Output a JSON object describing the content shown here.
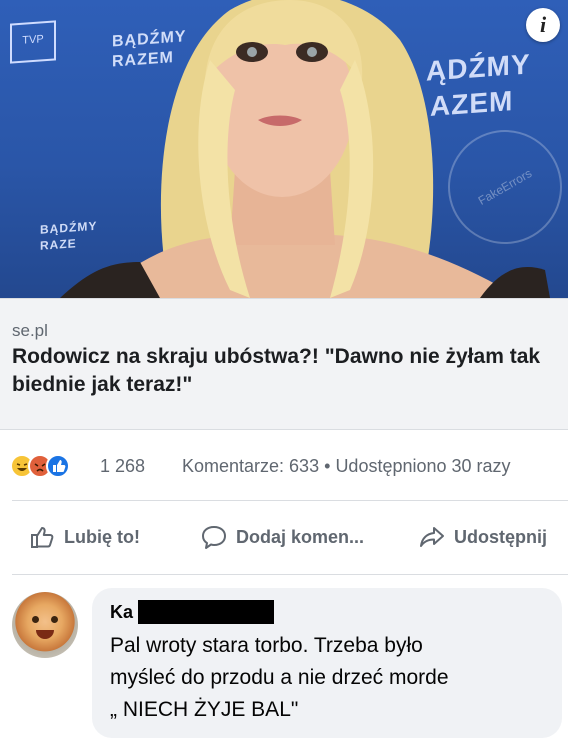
{
  "post_image": {
    "tv_logo": "TVP",
    "backdrop_text_left": "BĄDŹMY RAZEM",
    "backdrop_text_right_1": "ĄDŹMY",
    "backdrop_text_right_2": "AZEM",
    "backdrop_text_low": "BĄDŹMY RAZE",
    "watermark": "FakeErrors",
    "info_icon": "info-icon"
  },
  "link_preview": {
    "domain": "se.pl",
    "title": "Rodowicz na skraju ubóstwa?! \"Dawno nie żyłam tak biednie jak teraz!\""
  },
  "stats": {
    "reaction_icons": [
      "haha-icon",
      "angry-icon",
      "like-icon"
    ],
    "reaction_count": "1 268",
    "comments": "Komentarze: 633",
    "separator": "•",
    "shares": "Udostępniono 30 razy"
  },
  "actions": {
    "like_label": "Lubię to!",
    "comment_label": "Dodaj komen...",
    "share_label": "Udostępnij"
  },
  "comment": {
    "author_visible": "Ka",
    "lines": [
      "Pal wroty stara torbo. Trzeba było",
      "myśleć do przodu a nie drzeć morde",
      "„ NIECH ŻYJE BAL\""
    ]
  },
  "colors": {
    "photo_bg": "#2a56a8",
    "link_bg": "#f2f3f5",
    "secondary_text": "#606770",
    "primary_text": "#1c1e21",
    "like_blue": "#1b74e4",
    "bubble_bg": "#f0f2f5"
  }
}
